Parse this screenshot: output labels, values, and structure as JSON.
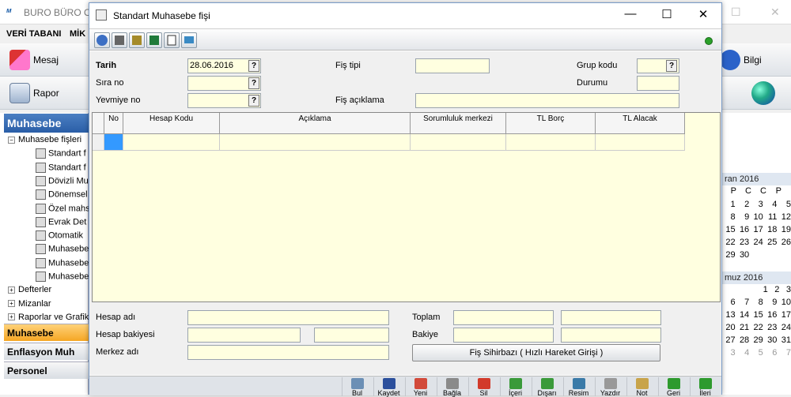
{
  "app": {
    "title": "BURO BÜRO OT",
    "window_controls": [
      "–",
      "☐",
      "✕"
    ],
    "menu": [
      "VERİ TABANI",
      "MİK"
    ],
    "toolbar1": [
      {
        "label": "Mesaj"
      },
      {
        "label": "Bilgi"
      }
    ],
    "toolbar2": [
      {
        "label": "Rapor"
      }
    ]
  },
  "sidebar": {
    "header": "Muhasebe",
    "tree": [
      {
        "label": "Muhasebe fişleri",
        "expander": "−",
        "level": 0
      },
      {
        "label": "Standart f",
        "level": 1
      },
      {
        "label": "Standart f",
        "level": 1
      },
      {
        "label": "Dövizli Mu",
        "level": 1
      },
      {
        "label": "Dönemsel",
        "level": 1
      },
      {
        "label": "Özel mahs",
        "level": 1
      },
      {
        "label": "Evrak Det",
        "level": 1
      },
      {
        "label": "Otomatik",
        "level": 1
      },
      {
        "label": "Muhasebe",
        "level": 1
      },
      {
        "label": "Muhasebe",
        "level": 1
      },
      {
        "label": "Muhasebe",
        "level": 1
      },
      {
        "label": "Defterler",
        "expander": "+",
        "level": 0
      },
      {
        "label": "Mizanlar",
        "expander": "+",
        "level": 0
      },
      {
        "label": "Raporlar ve Grafik",
        "expander": "+",
        "level": 0
      }
    ],
    "nav": [
      {
        "label": "Muhasebe",
        "active": true
      },
      {
        "label": "Enflasyon Muh",
        "active": false
      },
      {
        "label": "Personel",
        "active": false
      }
    ]
  },
  "calendar": {
    "month1": "ran 2016",
    "weekdays": [
      "P",
      "C",
      "C",
      "P"
    ],
    "month1_rows": [
      [
        "1",
        "2",
        "3",
        "4",
        "5"
      ],
      [
        "8",
        "9",
        "10",
        "11",
        "12"
      ],
      [
        "15",
        "16",
        "17",
        "18",
        "19"
      ],
      [
        "22",
        "23",
        "24",
        "25",
        "26"
      ],
      [
        "29",
        "30",
        "",
        "",
        ""
      ]
    ],
    "month2": "muz 2016",
    "month2_rows": [
      [
        "",
        "",
        "",
        "1",
        "2",
        "3"
      ],
      [
        "6",
        "7",
        "8",
        "9",
        "10"
      ],
      [
        "13",
        "14",
        "15",
        "16",
        "17"
      ],
      [
        "20",
        "21",
        "22",
        "23",
        "24"
      ],
      [
        "27",
        "28",
        "29",
        "30",
        "31"
      ],
      [
        "3",
        "4",
        "5",
        "6",
        "7"
      ]
    ]
  },
  "dialog": {
    "title": "Standart Muhasebe fişi",
    "controls": {
      "minimize": "—",
      "maximize": "☐",
      "close": "✕"
    },
    "fields": {
      "tarih_label": "Tarih",
      "tarih_value": "28.06.2016",
      "sira_label": "Sıra no",
      "sira_value": "",
      "yevmiye_label": "Yevmiye no",
      "yevmiye_value": "",
      "fis_tipi_label": "Fiş tipi",
      "fis_tipi_value": "",
      "fis_aciklama_label": "Fiş açıklama",
      "fis_aciklama_value": "",
      "grup_kodu_label": "Grup kodu",
      "grup_kodu_value": "",
      "durumu_label": "Durumu",
      "durumu_value": "",
      "lookup_glyph": "?"
    },
    "grid": {
      "columns": [
        "No",
        "Hesap Kodu",
        "Açıklama",
        "Sorumluluk merkezi",
        "TL Borç",
        "TL Alacak"
      ],
      "rows": [
        [
          "",
          "",
          "",
          "",
          "",
          ""
        ]
      ]
    },
    "footer": {
      "hesap_adi_label": "Hesap adı",
      "hesap_bakiyesi_label": "Hesap bakiyesi",
      "merkez_adi_label": "Merkez adı",
      "toplam_label": "Toplam",
      "bakiye_label": "Bakiye",
      "wizard_button": "Fiş Sihirbazı ( Hızlı Hareket Girişi )"
    },
    "bottom_buttons": [
      {
        "label": "Bul",
        "icon": "magnifier-icon",
        "color": "#6b8fb5"
      },
      {
        "label": "Kaydet",
        "icon": "floppy-icon",
        "color": "#2b4f9c"
      },
      {
        "label": "Yeni",
        "icon": "new-document-icon",
        "color": "#d24a3a"
      },
      {
        "label": "Bağla",
        "icon": "link-icon",
        "color": "#8a8a8a"
      },
      {
        "label": "Sil",
        "icon": "delete-icon",
        "color": "#d23a2a"
      },
      {
        "label": "İçeri",
        "icon": "import-icon",
        "color": "#3a9a3a"
      },
      {
        "label": "Dışarı",
        "icon": "export-icon",
        "color": "#3a9a3a"
      },
      {
        "label": "Resim",
        "icon": "picture-icon",
        "color": "#3a7aa8"
      },
      {
        "label": "Yazdır",
        "icon": "printer-icon",
        "color": "#999999"
      },
      {
        "label": "Not",
        "icon": "note-icon",
        "color": "#c8a44a"
      },
      {
        "label": "Geri",
        "icon": "back-arrow-icon",
        "color": "#2e9a2e"
      },
      {
        "label": "İleri",
        "icon": "forward-arrow-icon",
        "color": "#2e9a2e"
      }
    ]
  }
}
